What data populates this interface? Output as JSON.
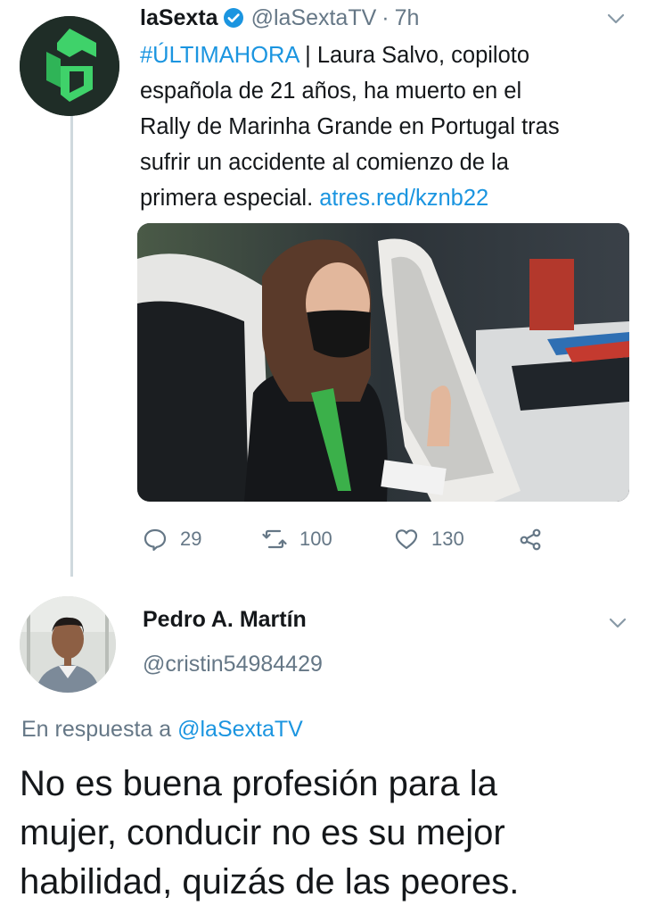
{
  "colors": {
    "text": "#14171a",
    "secondary": "#657786",
    "link": "#1b95e0",
    "brand_green": "#3fd26a"
  },
  "original_tweet": {
    "display_name": "laSexta",
    "verified_icon": "verified-badge-icon",
    "handle": "@laSextaTV",
    "time": "7h",
    "hashtag": "#ÚLTIMAHORA",
    "text_lines": [
      " | Laura Salvo, copiloto",
      "española de 21 años, ha muerto en el",
      "Rally de Marinha Grande en Portugal tras",
      "sufrir un accidente al comienzo de la",
      "primera especial. "
    ],
    "link": "atres.red/kznb22",
    "media_icon": "photo-rally-copilot",
    "actions": {
      "reply_count": "29",
      "retweet_count": "100",
      "like_count": "130"
    }
  },
  "reply_tweet": {
    "display_name": "Pedro A. Martín",
    "handle": "@cristin54984429",
    "in_reply_prefix": "En respuesta a ",
    "in_reply_mention": "@laSextaTV",
    "text_lines": [
      "No es buena profesión para la",
      "mujer, conducir no es su mejor",
      "habilidad, quizás de las peores."
    ]
  }
}
